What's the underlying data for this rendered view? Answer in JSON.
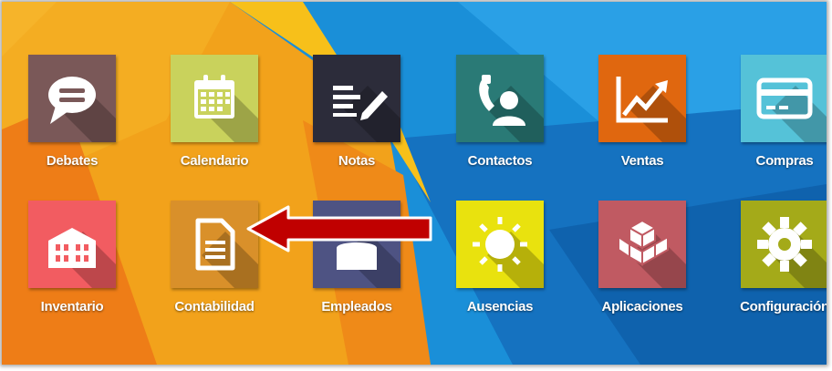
{
  "apps": [
    {
      "label": "Debates",
      "icon": "chat-bubble-icon",
      "color": "#7a5858"
    },
    {
      "label": "Calendario",
      "icon": "calendar-icon",
      "color": "#c9d25c"
    },
    {
      "label": "Notas",
      "icon": "notes-pencil-icon",
      "color": "#2c2c3a"
    },
    {
      "label": "Contactos",
      "icon": "phone-contact-icon",
      "color": "#2a7a76"
    },
    {
      "label": "Ventas",
      "icon": "trend-chart-icon",
      "color": "#e0670f"
    },
    {
      "label": "Compras",
      "icon": "credit-card-icon",
      "color": "#55c2d8"
    },
    {
      "label": "Inventario",
      "icon": "warehouse-building-icon",
      "color": "#f25c61"
    },
    {
      "label": "Contabilidad",
      "icon": "document-icon",
      "color": "#d9902a"
    },
    {
      "label": "Empleados",
      "icon": "employees-icon",
      "color": "#4e5383"
    },
    {
      "label": "Ausencias",
      "icon": "sun-icon",
      "color": "#e9e20e"
    },
    {
      "label": "Aplicaciones",
      "icon": "cubes-icon",
      "color": "#c05a62"
    },
    {
      "label": "Configuración",
      "icon": "gear-icon",
      "color": "#a4aa19"
    }
  ],
  "highlight": {
    "target": "Contabilidad",
    "arrow_color": "#c00000"
  }
}
